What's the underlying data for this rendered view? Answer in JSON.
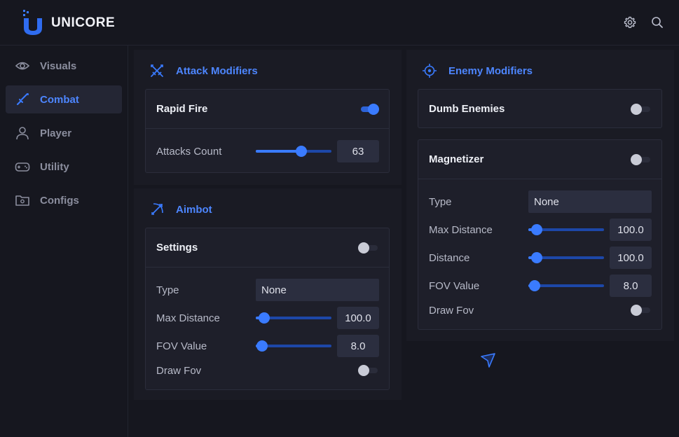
{
  "app": {
    "brand": "UNICORE"
  },
  "sidebar": {
    "items": [
      {
        "label": "Visuals",
        "icon": "eye-icon"
      },
      {
        "label": "Combat",
        "icon": "sword-icon"
      },
      {
        "label": "Player",
        "icon": "user-icon"
      },
      {
        "label": "Utility",
        "icon": "gamepad-icon"
      },
      {
        "label": "Configs",
        "icon": "folder-gear-icon"
      }
    ],
    "active": "Combat"
  },
  "sections": {
    "attack": {
      "title": "Attack Modifiers",
      "rapid_fire": {
        "label": "Rapid Fire",
        "on": true
      },
      "attacks_count": {
        "label": "Attacks Count",
        "value": "63",
        "fraction": 0.6
      }
    },
    "aimbot": {
      "title": "Aimbot",
      "settings": {
        "label": "Settings",
        "on": false
      },
      "type": {
        "label": "Type",
        "value": "None"
      },
      "max_distance": {
        "label": "Max Distance",
        "value": "100.0",
        "fraction": 0.11
      },
      "fov_value": {
        "label": "FOV Value",
        "value": "8.0",
        "fraction": 0.08
      },
      "draw_fov": {
        "label": "Draw Fov",
        "on": false
      }
    },
    "enemy": {
      "title": "Enemy Modifiers",
      "dumb_enemies": {
        "label": "Dumb Enemies",
        "on": false
      },
      "magnetizer": {
        "label": "Magnetizer",
        "on": false
      },
      "type": {
        "label": "Type",
        "value": "None"
      },
      "max_distance": {
        "label": "Max Distance",
        "value": "100.0",
        "fraction": 0.11
      },
      "distance": {
        "label": "Distance",
        "value": "100.0",
        "fraction": 0.11
      },
      "fov_value": {
        "label": "FOV Value",
        "value": "8.0",
        "fraction": 0.08
      },
      "draw_fov": {
        "label": "Draw Fov",
        "on": false
      }
    }
  },
  "colors": {
    "accent": "#3a7bff",
    "background": "#16171f",
    "panel": "#1e1f2a"
  }
}
